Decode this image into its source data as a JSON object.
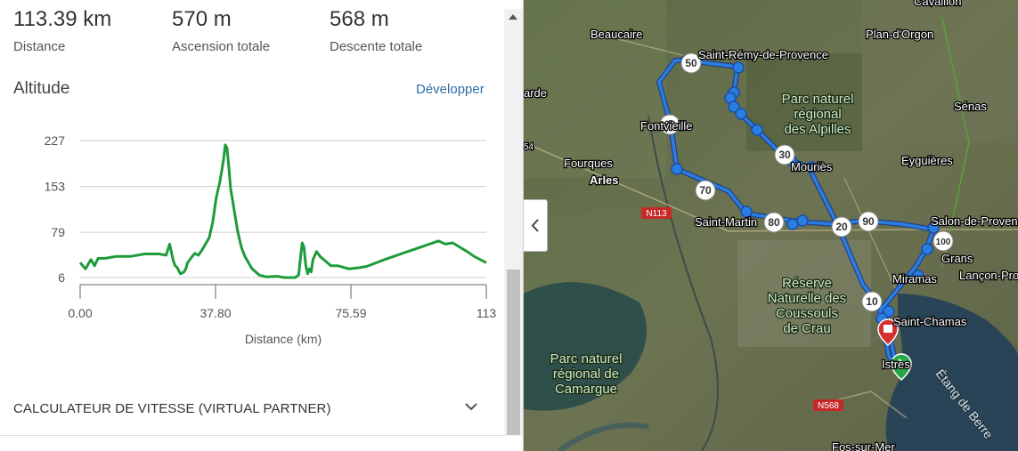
{
  "stats": [
    {
      "value": "113.39 km",
      "label": "Distance"
    },
    {
      "value": "570 m",
      "label": "Ascension totale"
    },
    {
      "value": "568 m",
      "label": "Descente totale"
    }
  ],
  "altitude": {
    "title": "Altitude",
    "expand_label": "Développer"
  },
  "chart_data": {
    "type": "line",
    "title": "",
    "xlabel": "Distance (km)",
    "ylabel": "",
    "x_ticks": [
      "0.00",
      "37.80",
      "75.59",
      "113"
    ],
    "y_ticks": [
      "227",
      "153",
      "79",
      "6"
    ],
    "xlim": [
      0,
      113.39
    ],
    "ylim": [
      6,
      227
    ],
    "grid": true,
    "line_color": "#1e9b3a",
    "series": [
      {
        "x": [
          0,
          1.5,
          3,
          4,
          5,
          7,
          10,
          14,
          18,
          22,
          24,
          25,
          26,
          26.5,
          27,
          28,
          29,
          29.5,
          30,
          31,
          32,
          33,
          34,
          36,
          37,
          38,
          39,
          40,
          40.5,
          41,
          41.5,
          42,
          43,
          44,
          45,
          46,
          47,
          48,
          49,
          50,
          52,
          55,
          57,
          60,
          61,
          62,
          62.5,
          63,
          63.5,
          64,
          64.5,
          65,
          66,
          67,
          68,
          69,
          70,
          72,
          75,
          78,
          80,
          85,
          90,
          95,
          100,
          102,
          104,
          106,
          108,
          110,
          113.39
        ],
        "y": [
          30,
          20,
          35,
          25,
          37,
          37,
          40,
          40,
          44,
          44,
          42,
          60,
          33,
          25,
          23,
          12,
          15,
          20,
          30,
          38,
          45,
          42,
          50,
          70,
          95,
          135,
          160,
          195,
          220,
          215,
          185,
          150,
          115,
          80,
          55,
          40,
          30,
          20,
          15,
          10,
          7,
          8,
          6,
          6,
          10,
          62,
          55,
          25,
          12,
          20,
          15,
          35,
          48,
          40,
          35,
          30,
          25,
          25,
          20,
          22,
          24,
          35,
          45,
          55,
          65,
          60,
          62,
          55,
          48,
          40,
          30
        ]
      }
    ]
  },
  "calculator": {
    "label": "CALCULATEUR DE VITESSE (VIRTUAL PARTNER)"
  },
  "map": {
    "places": [
      {
        "text": "Beaucaire"
      },
      {
        "text": "Saint-Rémy-de-Provence"
      },
      {
        "text": "Plan-d'Orgon"
      },
      {
        "text": "Cavaillon"
      },
      {
        "text": "arde"
      },
      {
        "text": "Parc naturel\nrégional\ndes Alpilles"
      },
      {
        "text": "Sénas"
      },
      {
        "text": "Fontvieille"
      },
      {
        "text": "Fourques"
      },
      {
        "text": "Arles"
      },
      {
        "text": "Mouriès"
      },
      {
        "text": "Eyguières"
      },
      {
        "text": "N113"
      },
      {
        "text": "Saint-Martin"
      },
      {
        "text": "Salon-de-Provence"
      },
      {
        "text": "Grans"
      },
      {
        "text": "Lançon-Provence"
      },
      {
        "text": "Miramas"
      },
      {
        "text": "Réserve\nNaturelle des\nCoussouls\nde Crau"
      },
      {
        "text": "Saint-Chamas"
      },
      {
        "text": "Istres"
      },
      {
        "text": "Parc naturel\nrégional de\nCamargue"
      },
      {
        "text": "Étang de Berre"
      },
      {
        "text": "N568"
      },
      {
        "text": "Fos-sur-Mer"
      },
      {
        "text": "54"
      }
    ],
    "markers": [
      "10",
      "20",
      "30",
      "50",
      "60",
      "70",
      "80",
      "90",
      "100"
    ],
    "route_color": "#2a7de1"
  }
}
